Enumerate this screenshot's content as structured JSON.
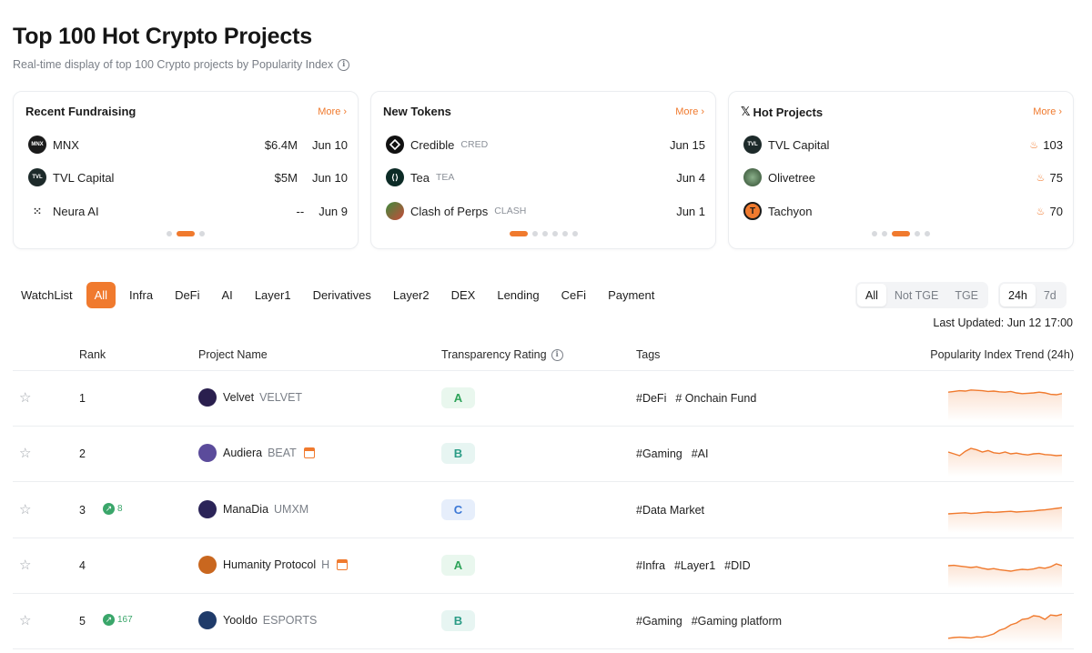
{
  "header": {
    "title": "Top 100 Hot Crypto Projects",
    "subtitle": "Real-time display of top 100 Crypto projects by Popularity Index"
  },
  "cards": {
    "fundraising": {
      "title": "Recent Fundraising",
      "more": "More",
      "items": [
        {
          "name": "MNX",
          "amount": "$6.4M",
          "date": "Jun 10",
          "logo_text": "MNX"
        },
        {
          "name": "TVL Capital",
          "amount": "$5M",
          "date": "Jun 10",
          "logo_text": "TVL"
        },
        {
          "name": "Neura AI",
          "amount": "--",
          "date": "Jun 9",
          "logo_text": ""
        }
      ]
    },
    "new_tokens": {
      "title": "New Tokens",
      "more": "More",
      "items": [
        {
          "name": "Credible",
          "symbol": "CRED",
          "date": "Jun 15"
        },
        {
          "name": "Tea",
          "symbol": "TEA",
          "date": "Jun 4"
        },
        {
          "name": "Clash of Perps",
          "symbol": "CLASH",
          "date": "Jun 1"
        }
      ]
    },
    "hot_projects": {
      "title_prefix": "𝕏",
      "title": "Hot Projects",
      "more": "More",
      "items": [
        {
          "name": "TVL Capital",
          "score": "103",
          "logo_text": "TVL"
        },
        {
          "name": "Olivetree",
          "score": "75",
          "logo_text": ""
        },
        {
          "name": "Tachyon",
          "score": "70",
          "logo_text": "T"
        }
      ]
    }
  },
  "category_tabs": [
    "WatchList",
    "All",
    "Infra",
    "DeFi",
    "AI",
    "Layer1",
    "Derivatives",
    "Layer2",
    "DEX",
    "Lending",
    "CeFi",
    "Payment"
  ],
  "active_category": "All",
  "tge_filter": {
    "options": [
      "All",
      "Not TGE",
      "TGE"
    ],
    "active": "All"
  },
  "time_filter": {
    "options": [
      "24h",
      "7d"
    ],
    "active": "24h"
  },
  "last_updated": "Last Updated: Jun 12 17:00",
  "table": {
    "headers": {
      "rank": "Rank",
      "project": "Project Name",
      "rating": "Transparency Rating",
      "tags": "Tags",
      "trend": "Popularity Index Trend (24h)"
    },
    "rows": [
      {
        "rank": "1",
        "rise": "",
        "name": "Velvet",
        "symbol": "VELVET",
        "calendar": false,
        "rating": "A",
        "tags": [
          "#DeFi",
          "# Onchain Fund"
        ],
        "logo_color": "#2a1f4e",
        "trend": [
          0.72,
          0.74,
          0.76,
          0.75,
          0.78,
          0.77,
          0.76,
          0.74,
          0.75,
          0.73,
          0.72,
          0.74,
          0.7,
          0.68,
          0.69,
          0.7,
          0.72,
          0.7,
          0.66,
          0.65,
          0.68
        ]
      },
      {
        "rank": "2",
        "rise": "",
        "name": "Audiera",
        "symbol": "BEAT",
        "calendar": true,
        "rating": "B",
        "tags": [
          "#Gaming",
          "#AI"
        ],
        "logo_color": "#5b4b9b",
        "trend": [
          0.6,
          0.55,
          0.5,
          0.62,
          0.7,
          0.66,
          0.6,
          0.64,
          0.58,
          0.56,
          0.6,
          0.55,
          0.57,
          0.54,
          0.52,
          0.55,
          0.56,
          0.53,
          0.52,
          0.5,
          0.51
        ]
      },
      {
        "rank": "3",
        "rise": "8",
        "name": "ManaDia",
        "symbol": "UMXM",
        "calendar": false,
        "rating": "C",
        "tags": [
          "#Data Market"
        ],
        "logo_color": "#2b2458",
        "trend": [
          0.45,
          0.46,
          0.47,
          0.48,
          0.46,
          0.47,
          0.49,
          0.5,
          0.49,
          0.5,
          0.51,
          0.52,
          0.5,
          0.51,
          0.52,
          0.53,
          0.55,
          0.56,
          0.58,
          0.6,
          0.62
        ]
      },
      {
        "rank": "4",
        "rise": "",
        "name": "Humanity Protocol",
        "symbol": "H",
        "calendar": true,
        "rating": "A",
        "tags": [
          "#Infra",
          "#Layer1",
          "#DID"
        ],
        "logo_color": "#c9671f",
        "trend": [
          0.55,
          0.56,
          0.54,
          0.52,
          0.5,
          0.52,
          0.48,
          0.45,
          0.47,
          0.44,
          0.42,
          0.4,
          0.43,
          0.45,
          0.44,
          0.46,
          0.5,
          0.48,
          0.52,
          0.6,
          0.55
        ]
      },
      {
        "rank": "5",
        "rise": "167",
        "name": "Yooldo",
        "symbol": "ESPORTS",
        "calendar": false,
        "rating": "B",
        "tags": [
          "#Gaming",
          "#Gaming platform"
        ],
        "logo_color": "#1f3b6a",
        "trend": [
          0.08,
          0.1,
          0.11,
          0.1,
          0.09,
          0.12,
          0.11,
          0.15,
          0.2,
          0.3,
          0.35,
          0.45,
          0.5,
          0.6,
          0.62,
          0.7,
          0.68,
          0.6,
          0.72,
          0.7,
          0.74
        ]
      }
    ]
  },
  "colors": {
    "accent": "#f07a2e",
    "rise": "#3aa66a"
  }
}
